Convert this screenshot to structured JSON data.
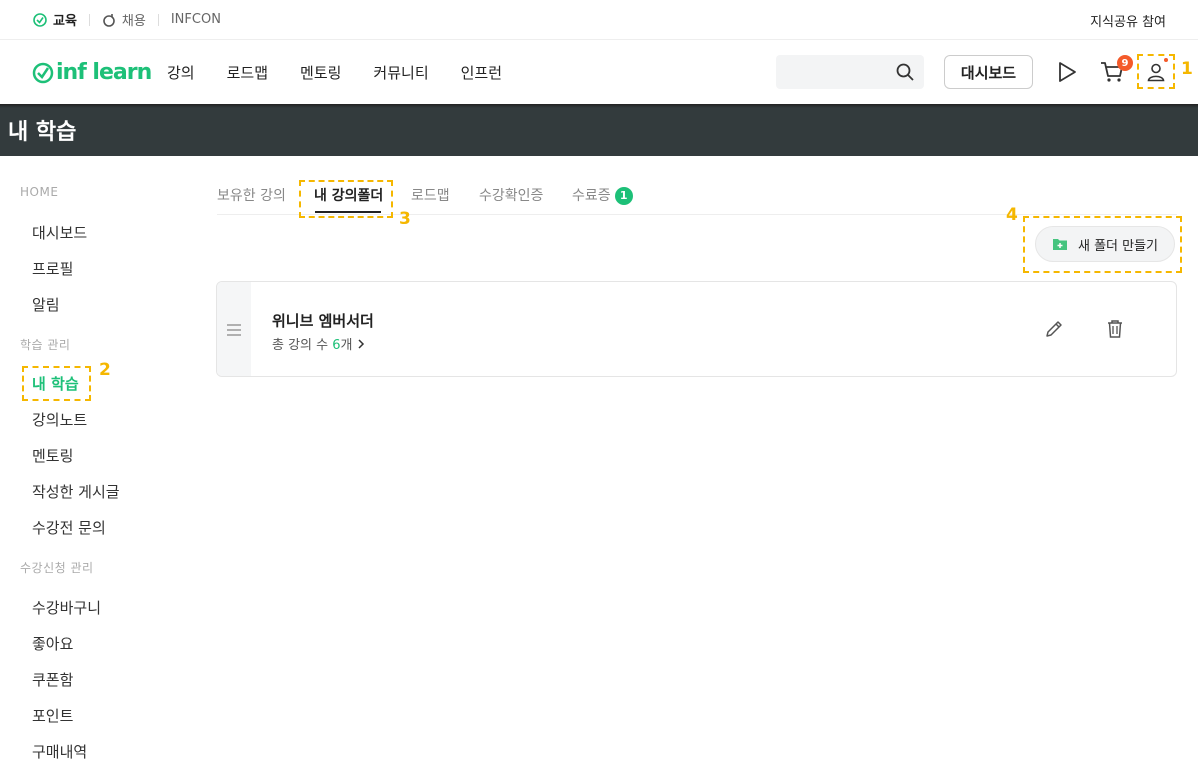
{
  "topbar": {
    "items": [
      {
        "label": "교육",
        "icon": "edu-icon"
      },
      {
        "label": "채용",
        "icon": "job-icon"
      },
      {
        "label": "INFCON"
      }
    ],
    "right_link": "지식공유 참여"
  },
  "header": {
    "logo_text": "inf learn",
    "nav": [
      "강의",
      "로드맵",
      "멘토링",
      "커뮤니티",
      "인프런"
    ],
    "search_placeholder": "",
    "dashboard_label": "대시보드",
    "cart_count": "9"
  },
  "page_title": "내 학습",
  "sidebar": {
    "home_label": "HOME",
    "group1": [
      "대시보드",
      "프로필",
      "알림"
    ],
    "learn_section": "학습 관리",
    "group2": [
      "내 학습",
      "강의노트",
      "멘토링",
      "작성한 게시글",
      "수강전 문의"
    ],
    "enroll_section": "수강신청 관리",
    "group3": [
      "수강바구니",
      "좋아요",
      "쿠폰함",
      "포인트",
      "구매내역"
    ]
  },
  "tabs": [
    {
      "label": "보유한 강의"
    },
    {
      "label": "내 강의폴더"
    },
    {
      "label": "로드맵"
    },
    {
      "label": "수강확인증"
    },
    {
      "label": "수료증",
      "badge": "1"
    }
  ],
  "new_folder_label": "새 폴더 만들기",
  "folder": {
    "title": "위니브 엠버서더",
    "count_prefix": "총 강의 수 ",
    "count": "6",
    "count_suffix": "개"
  },
  "annotations": [
    "1",
    "2",
    "3",
    "4"
  ],
  "colors": {
    "brand": "#1dc078",
    "highlight": "#f5b700",
    "badge": "#f45a2a",
    "band": "#333b3d"
  }
}
